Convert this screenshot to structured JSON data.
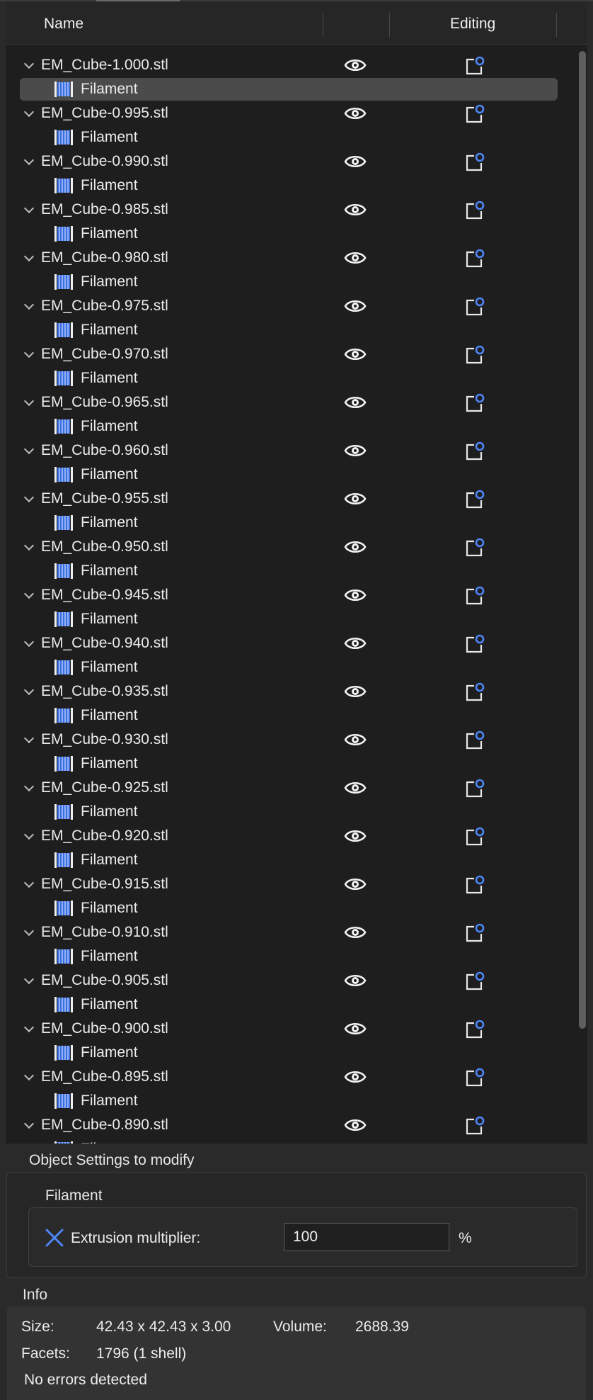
{
  "header": {
    "name": "Name",
    "visible": "",
    "editing": "Editing"
  },
  "objects": [
    {
      "name": "EM_Cube-1.000.stl",
      "child": "Filament",
      "selected_child": true
    },
    {
      "name": "EM_Cube-0.995.stl",
      "child": "Filament"
    },
    {
      "name": "EM_Cube-0.990.stl",
      "child": "Filament"
    },
    {
      "name": "EM_Cube-0.985.stl",
      "child": "Filament"
    },
    {
      "name": "EM_Cube-0.980.stl",
      "child": "Filament"
    },
    {
      "name": "EM_Cube-0.975.stl",
      "child": "Filament"
    },
    {
      "name": "EM_Cube-0.970.stl",
      "child": "Filament"
    },
    {
      "name": "EM_Cube-0.965.stl",
      "child": "Filament"
    },
    {
      "name": "EM_Cube-0.960.stl",
      "child": "Filament"
    },
    {
      "name": "EM_Cube-0.955.stl",
      "child": "Filament"
    },
    {
      "name": "EM_Cube-0.950.stl",
      "child": "Filament"
    },
    {
      "name": "EM_Cube-0.945.stl",
      "child": "Filament"
    },
    {
      "name": "EM_Cube-0.940.stl",
      "child": "Filament"
    },
    {
      "name": "EM_Cube-0.935.stl",
      "child": "Filament"
    },
    {
      "name": "EM_Cube-0.930.stl",
      "child": "Filament"
    },
    {
      "name": "EM_Cube-0.925.stl",
      "child": "Filament"
    },
    {
      "name": "EM_Cube-0.920.stl",
      "child": "Filament"
    },
    {
      "name": "EM_Cube-0.915.stl",
      "child": "Filament"
    },
    {
      "name": "EM_Cube-0.910.stl",
      "child": "Filament"
    },
    {
      "name": "EM_Cube-0.905.stl",
      "child": "Filament"
    },
    {
      "name": "EM_Cube-0.900.stl",
      "child": "Filament"
    },
    {
      "name": "EM_Cube-0.895.stl",
      "child": "Filament"
    },
    {
      "name": "EM_Cube-0.890.stl",
      "child": "Filament"
    }
  ],
  "icons": {
    "expander": "chevron-down-icon",
    "child": "filament-spool-icon",
    "visible": "eye-icon",
    "edit": "edit-settings-icon",
    "remove": "close-x-icon"
  },
  "colors": {
    "accent": "#4f86f7",
    "selection": "#4b4b4b"
  },
  "settings": {
    "title": "Object Settings to modify",
    "group": "Filament",
    "option_label": "Extrusion multiplier:",
    "option_value": "100",
    "option_unit": "%"
  },
  "info": {
    "title": "Info",
    "size_label": "Size:",
    "size_value": "42.43 x 42.43 x 3.00",
    "volume_label": "Volume:",
    "volume_value": "2688.39",
    "facets_label": "Facets:",
    "facets_value": "1796 (1 shell)",
    "status": "No errors detected"
  }
}
